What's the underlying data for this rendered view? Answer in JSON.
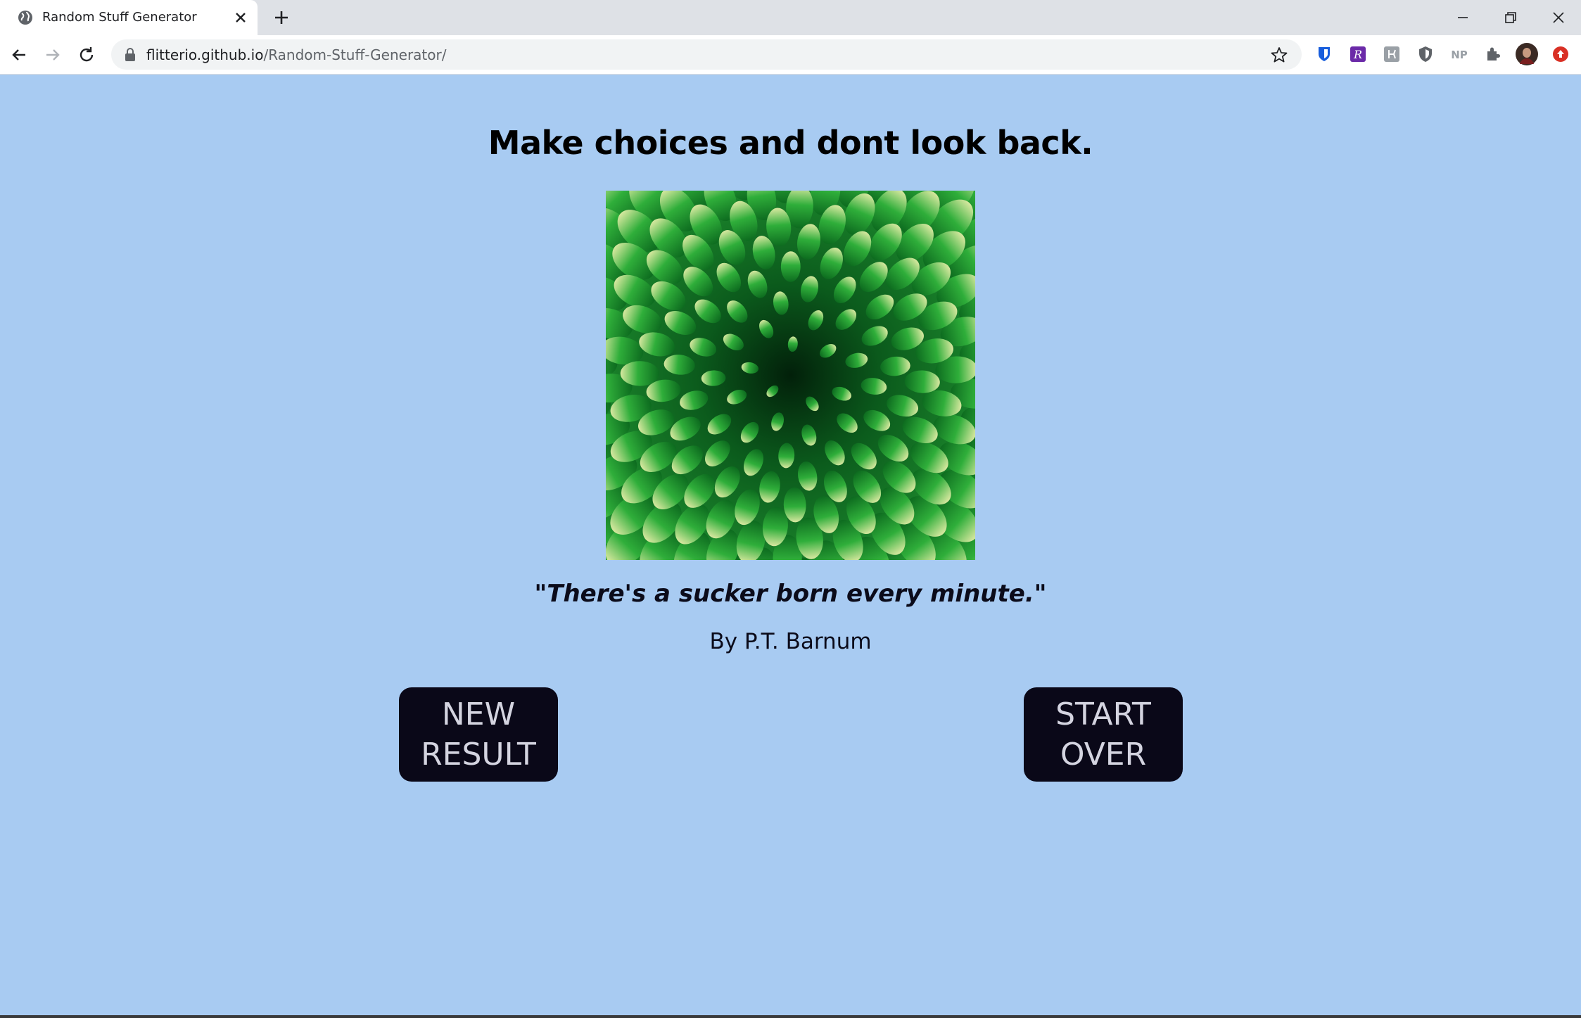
{
  "browser": {
    "tab_title": "Random Stuff Generator",
    "url_host": "flitterio.github.io",
    "url_path": "/Random-Stuff-Generator/",
    "extensions": [
      "bitwarden-icon",
      "readwise-icon",
      "extension-icon",
      "shield-icon",
      "np-icon",
      "puzzle-icon",
      "profile-avatar",
      "update-icon"
    ],
    "ext_np_label": "NP"
  },
  "page": {
    "headline": "Make choices and dont look back.",
    "image_description_name": "green-spiky-succulent-image",
    "quote": "\"There's a sucker born every minute.\"",
    "author": "By P.T. Barnum",
    "new_result_label": "NEW\nRESULT",
    "start_over_label": "START\nOVER"
  },
  "colors": {
    "background": "#a8cbf2",
    "button_bg": "#0a0818",
    "button_text": "#d4d4e0"
  }
}
